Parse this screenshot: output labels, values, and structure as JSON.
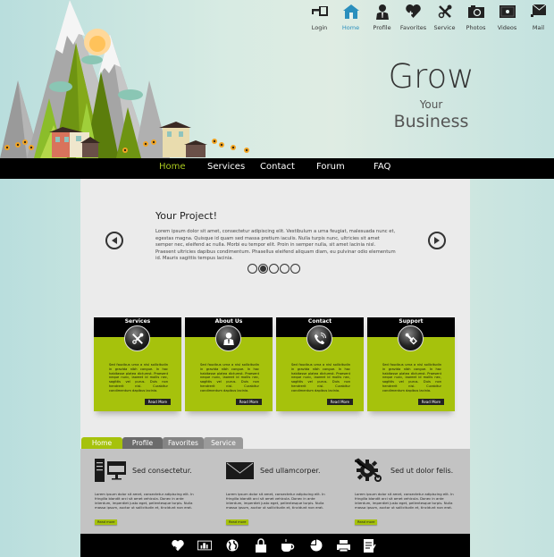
{
  "header": {
    "top_icons": [
      {
        "icon": "key-icon",
        "label": "Login",
        "active": false
      },
      {
        "icon": "home-icon",
        "label": "Home",
        "active": true
      },
      {
        "icon": "user-icon",
        "label": "Profile",
        "active": false
      },
      {
        "icon": "heart-plus-icon",
        "label": "Favorites",
        "active": false
      },
      {
        "icon": "tools-icon",
        "label": "Service",
        "active": false
      },
      {
        "icon": "camera-icon",
        "label": "Photos",
        "active": false
      },
      {
        "icon": "video-icon",
        "label": "Videos",
        "active": false
      },
      {
        "icon": "mail-icon",
        "label": "Mail",
        "active": false
      }
    ],
    "hero": {
      "line1": "Grow",
      "line2": "Your",
      "line3": "Business"
    }
  },
  "nav": {
    "items": [
      {
        "label": "Home",
        "active": true
      },
      {
        "label": "Services",
        "active": false
      },
      {
        "label": "Contact",
        "active": false
      },
      {
        "label": "Forum",
        "active": false
      },
      {
        "label": "FAQ",
        "active": false
      }
    ]
  },
  "slider": {
    "title": "Your Project!",
    "text": "Lorem ipsum dolor sit amet, consectetur adipiscing elit. Vestibulum a urna feugiat, malesuada nunc et, egestas magna. Quisque id quam sed massa pretium iaculis. Nulla turpis nunc, ultricies sit amet semper nec, eleifend ac nulla. Morbi eu tempor elit. Proin in semper nulla, sit amet lacinia nisl. Praesent ultricies dapibus condimentum. Phasellus eleifend aliquam diam, eu pulvinar odio elementum id. Mauris sagittis tempus lacinia.",
    "prev_icon": "arrow-left-icon",
    "next_icon": "arrow-right-icon",
    "slide_count": 5,
    "active_slide": 2
  },
  "cards": [
    {
      "title": "Services",
      "icon": "tools-icon",
      "text": "Sed faucibus urna a nisl sollicitudin in gravida nibh congue. In hac habitasse platea dictumst. Praesent neque nunc, laoreet id mollis nec, sagittis vel purus. Duis non hendrerit nisl. Curabitur condimentum dapibus lacinia.",
      "button": "Read More"
    },
    {
      "title": "About Us",
      "icon": "user-icon",
      "text": "Sed faucibus urna a nisl sollicitudin in gravida nibh congue. In hac habitasse platea dictumst. Praesent neque nunc, laoreet id mollis nec, sagittis vel purus. Duis non hendrerit nisl. Curabitur condimentum dapibus lacinia.",
      "button": "Read More"
    },
    {
      "title": "Contact",
      "icon": "phone-icon",
      "text": "Sed faucibus urna a nisl sollicitudin in gravida nibh congue. In hac habitasse platea dictumst. Praesent neque nunc, laoreet id mollis nec, sagittis vel purus. Duis non hendrerit nisl. Curabitur condimentum dapibus lacinia.",
      "button": "Read More"
    },
    {
      "title": "Support",
      "icon": "wrench-icon",
      "text": "Sed faucibus urna a nisl sollicitudin in gravida nibh congue. In hac habitasse platea dictumst. Praesent neque nunc, laoreet id mollis nec, sagittis vel purus. Duis non hendrerit nisl. Curabitur condimentum dapibus lacinia.",
      "button": "Read More"
    }
  ],
  "tabs": [
    {
      "label": "Home",
      "active": true
    },
    {
      "label": "Profile",
      "active": false
    },
    {
      "label": "Favorites",
      "active": false
    },
    {
      "label": "Service",
      "active": false
    }
  ],
  "features": [
    {
      "icon": "computer-icon",
      "title": "Sed consectetur.",
      "text": "Lorem ipsum dolor sit amet, consectetur adipiscing elit. In fringilla blandit orci sit amet vehicula. Donec in ante interdum, imperdiet justo eget, pellentesque turpis. Nulla massa ipsum, auctor ut sollicitudin et, tincidunt non erat.",
      "button": "Read more"
    },
    {
      "icon": "envelope-icon",
      "title": "Sed ullamcorper.",
      "text": "Lorem ipsum dolor sit amet, consectetur adipiscing elit. In fringilla blandit orci sit amet vehicula. Donec in ante interdum, imperdiet justo eget, pellentesque turpis. Nulla massa ipsum, auctor ut sollicitudin et, tincidunt non erat.",
      "button": "Read more"
    },
    {
      "icon": "gear-wrench-icon",
      "title": "Sed ut dolor felis.",
      "text": "Lorem ipsum dolor sit amet, consectetur adipiscing elit. In fringilla blandit orci sit amet vehicula. Donec in ante interdum, imperdiet justo eget, pellentesque turpis. Nulla massa ipsum, auctor ut sollicitudin et, tincidunt non erat.",
      "button": "Read more"
    }
  ],
  "footer_icons": [
    "heart-plus-icon",
    "image-icon",
    "globe-icon",
    "lock-icon",
    "coffee-icon",
    "pie-chart-icon",
    "printer-icon",
    "note-icon"
  ],
  "colors": {
    "accent": "#a6c20c",
    "active_link": "#2a8fbd",
    "nav_bg": "#000000",
    "panel_bg": "#ebebeb"
  }
}
